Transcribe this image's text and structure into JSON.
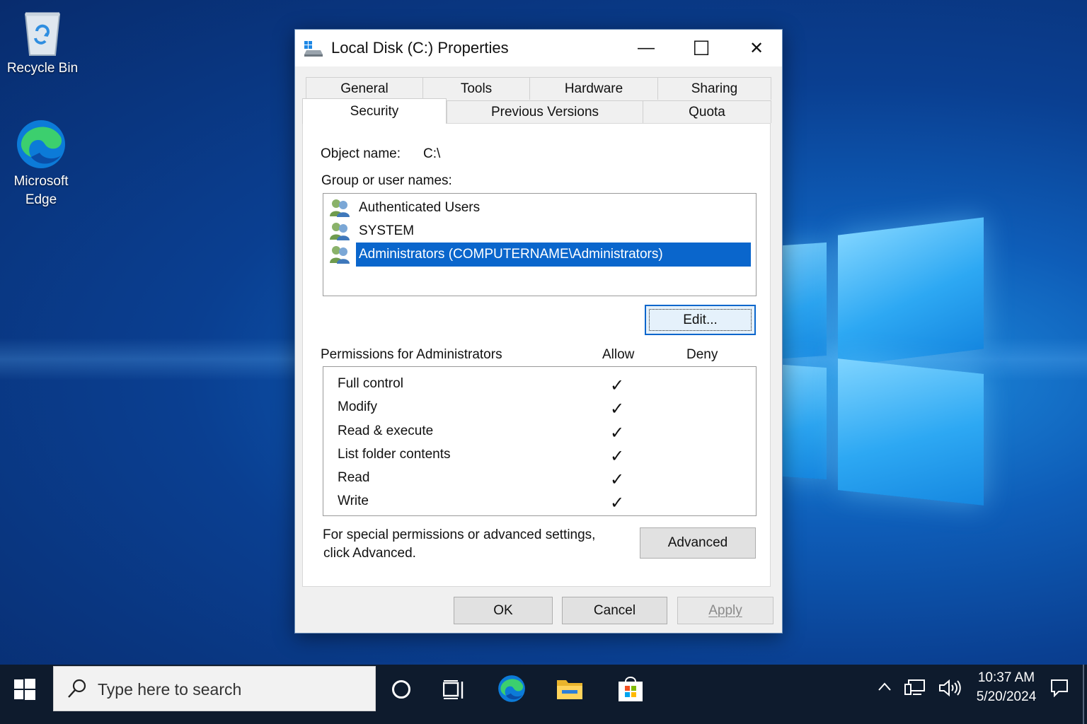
{
  "desktop": {
    "icons": [
      {
        "label": "Recycle Bin",
        "icon": "recycle-bin-icon"
      },
      {
        "label": "Microsoft Edge",
        "icon": "edge-icon"
      }
    ]
  },
  "dialog": {
    "title": "Local Disk (C:) Properties",
    "title_icon": "drive-icon",
    "controls": {
      "minimize": "—",
      "maximize": "☐",
      "close": "✕"
    },
    "tabs_row1": [
      "General",
      "Tools",
      "Hardware",
      "Sharing"
    ],
    "tabs_row2": [
      "Security",
      "Previous Versions",
      "Quota"
    ],
    "active_tab": "Security",
    "object_name_label": "Object name:",
    "object_name_value": "C:\\",
    "group_label": "Group or user names:",
    "users": [
      {
        "name": "Authenticated Users",
        "selected": false
      },
      {
        "name": "SYSTEM",
        "selected": false
      },
      {
        "name": "Administrators (COMPUTERNAME\\Administrators)",
        "selected": true
      }
    ],
    "edit_button": "Edit...",
    "permissions_label": "Permissions for Administrators",
    "allow_header": "Allow",
    "deny_header": "Deny",
    "permissions": [
      {
        "name": "Full control",
        "allow": true,
        "deny": false
      },
      {
        "name": "Modify",
        "allow": true,
        "deny": false
      },
      {
        "name": "Read & execute",
        "allow": true,
        "deny": false
      },
      {
        "name": "List folder contents",
        "allow": true,
        "deny": false
      },
      {
        "name": "Read",
        "allow": true,
        "deny": false
      },
      {
        "name": "Write",
        "allow": true,
        "deny": false
      }
    ],
    "advanced_note_line1": "For special permissions or advanced settings,",
    "advanced_note_line2": "click Advanced.",
    "advanced_button": "Advanced",
    "ok_button": "OK",
    "cancel_button": "Cancel",
    "apply_button": "Apply",
    "check_glyph": "✓"
  },
  "taskbar": {
    "search_placeholder": "Type here to search",
    "pinned": [
      "cortana-icon",
      "task-view-icon",
      "edge-icon",
      "file-explorer-icon",
      "store-icon"
    ],
    "time": "10:37 AM",
    "date": "5/20/2024"
  },
  "colors": {
    "selection": "#0a66cc",
    "taskbar": "#0e1b2d",
    "desktop_accent": "#1f8fe0"
  }
}
